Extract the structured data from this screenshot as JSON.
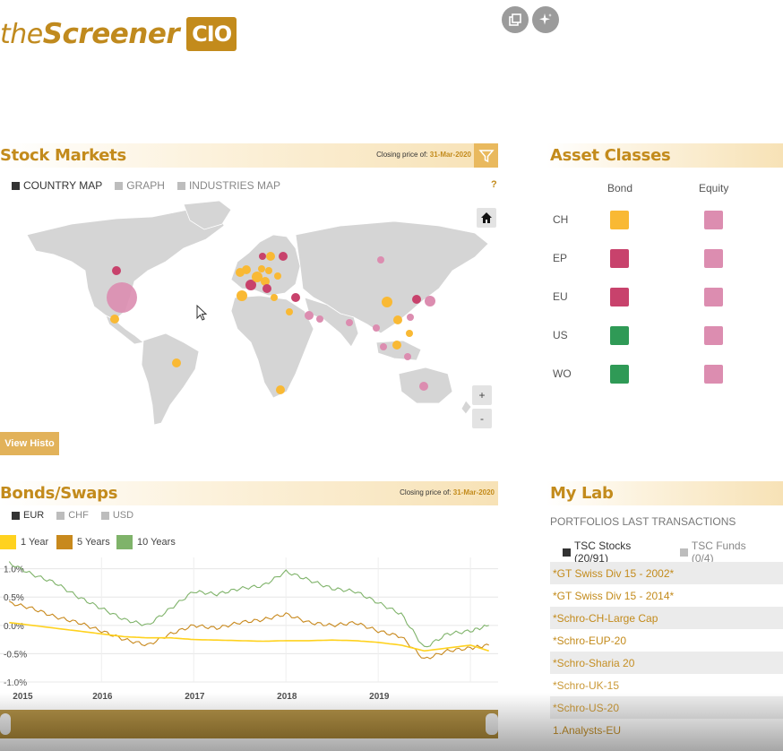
{
  "logo": {
    "part1": "the",
    "part2": "Screener",
    "badge": "CIO"
  },
  "stock_markets": {
    "title": "Stock Markets",
    "closing_label": "Closing price of:",
    "closing_date": "31-Mar-2020",
    "tabs": [
      "COUNTRY MAP",
      "GRAPH",
      "INDUSTRIES MAP"
    ],
    "help": "?",
    "view_histo": "View Histo",
    "zoom_in": "+",
    "zoom_out": "-"
  },
  "asset_classes": {
    "title": "Asset Classes",
    "columns": [
      "Bond",
      "Equity"
    ],
    "rows": [
      {
        "label": "CH",
        "bond": "#f9b934",
        "equity": "#dc8db0"
      },
      {
        "label": "EP",
        "bond": "#c8426c",
        "equity": "#dc8db0"
      },
      {
        "label": "EU",
        "bond": "#c8426c",
        "equity": "#dc8db0"
      },
      {
        "label": "US",
        "bond": "#2f9a56",
        "equity": "#dc8db0"
      },
      {
        "label": "WO",
        "bond": "#2f9a56",
        "equity": "#dc8db0"
      }
    ]
  },
  "bonds_swaps": {
    "title": "Bonds/Swaps",
    "closing_label": "Closing price of:",
    "closing_date": "31-Mar-2020",
    "currency_tabs": [
      "EUR",
      "CHF",
      "USD"
    ],
    "legend": [
      {
        "name": "1 Year",
        "color": "#ffd21f"
      },
      {
        "name": "5 Years",
        "color": "#c8891d"
      },
      {
        "name": "10 Years",
        "color": "#7fb36a"
      }
    ],
    "y_ticks": [
      "1.0%",
      "0.5%",
      "0.0%",
      "-0.5%",
      "-1.0%"
    ],
    "x_ticks": [
      "2015",
      "2016",
      "2017",
      "2018",
      "2019"
    ]
  },
  "chart_data": {
    "type": "line",
    "x": [
      2015.0,
      2015.25,
      2015.5,
      2015.75,
      2016.0,
      2016.25,
      2016.5,
      2016.75,
      2017.0,
      2017.25,
      2017.5,
      2017.75,
      2018.0,
      2018.25,
      2018.5,
      2018.75,
      2019.0,
      2019.25,
      2019.5,
      2019.75,
      2020.0,
      2020.2
    ],
    "series": [
      {
        "name": "1 Year",
        "values": [
          0.05,
          0.0,
          -0.05,
          -0.1,
          -0.15,
          -0.2,
          -0.22,
          -0.22,
          -0.25,
          -0.26,
          -0.27,
          -0.28,
          -0.27,
          -0.27,
          -0.26,
          -0.27,
          -0.3,
          -0.35,
          -0.45,
          -0.4,
          -0.35,
          -0.45
        ]
      },
      {
        "name": "5 Years",
        "values": [
          0.4,
          0.3,
          0.15,
          0.05,
          -0.1,
          -0.25,
          -0.35,
          -0.15,
          0.0,
          -0.05,
          0.05,
          0.1,
          0.2,
          0.05,
          0.0,
          0.05,
          -0.1,
          -0.2,
          -0.6,
          -0.45,
          -0.4,
          -0.35
        ]
      },
      {
        "name": "10 Years",
        "values": [
          1.1,
          0.9,
          0.75,
          0.5,
          0.3,
          0.1,
          0.0,
          0.3,
          0.6,
          0.55,
          0.65,
          0.7,
          0.95,
          0.8,
          0.65,
          0.6,
          0.4,
          0.2,
          -0.4,
          -0.15,
          -0.1,
          0.0
        ]
      }
    ],
    "ylim": [
      -1.0,
      1.2
    ],
    "xlim": [
      2014.9,
      2020.3
    ]
  },
  "my_lab": {
    "title": "My Lab",
    "subtitle": "PORTFOLIOS LAST TRANSACTIONS",
    "tabs": [
      "TSC Stocks (20/91)",
      "TSC Funds (0/4)"
    ],
    "items": [
      "*GT Swiss Div 15 - 2002*",
      "*GT Swiss Div 15 - 2014*",
      "*Schro-CH-Large Cap",
      "*Schro-EUP-20",
      "*Schro-Sharia 20",
      "*Schro-UK-15",
      "*Schro-US-20",
      "1.Analysts-EU"
    ]
  }
}
